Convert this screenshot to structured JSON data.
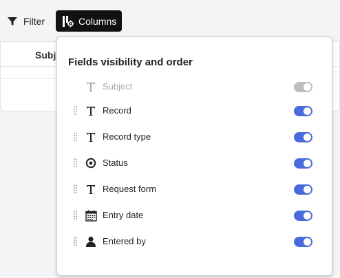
{
  "toolbar": {
    "filter_label": "Filter",
    "columns_label": "Columns"
  },
  "table": {
    "header_visible": "Subje"
  },
  "popover": {
    "title": "Fields visibility and order",
    "fields": [
      {
        "label": "Subject",
        "icon": "text-type-icon",
        "enabled": true,
        "locked": true
      },
      {
        "label": "Record",
        "icon": "text-type-icon",
        "enabled": true,
        "locked": false
      },
      {
        "label": "Record type",
        "icon": "text-type-icon",
        "enabled": true,
        "locked": false
      },
      {
        "label": "Status",
        "icon": "status-circle-icon",
        "enabled": true,
        "locked": false
      },
      {
        "label": "Request form",
        "icon": "text-type-icon",
        "enabled": true,
        "locked": false
      },
      {
        "label": "Entry date",
        "icon": "calendar-icon",
        "enabled": true,
        "locked": false
      },
      {
        "label": "Entered by",
        "icon": "person-icon",
        "enabled": true,
        "locked": false
      }
    ]
  },
  "colors": {
    "toggle_on": "#4a6bdc",
    "toggle_disabled": "#bdbdbd",
    "columns_button_bg": "#111111"
  }
}
